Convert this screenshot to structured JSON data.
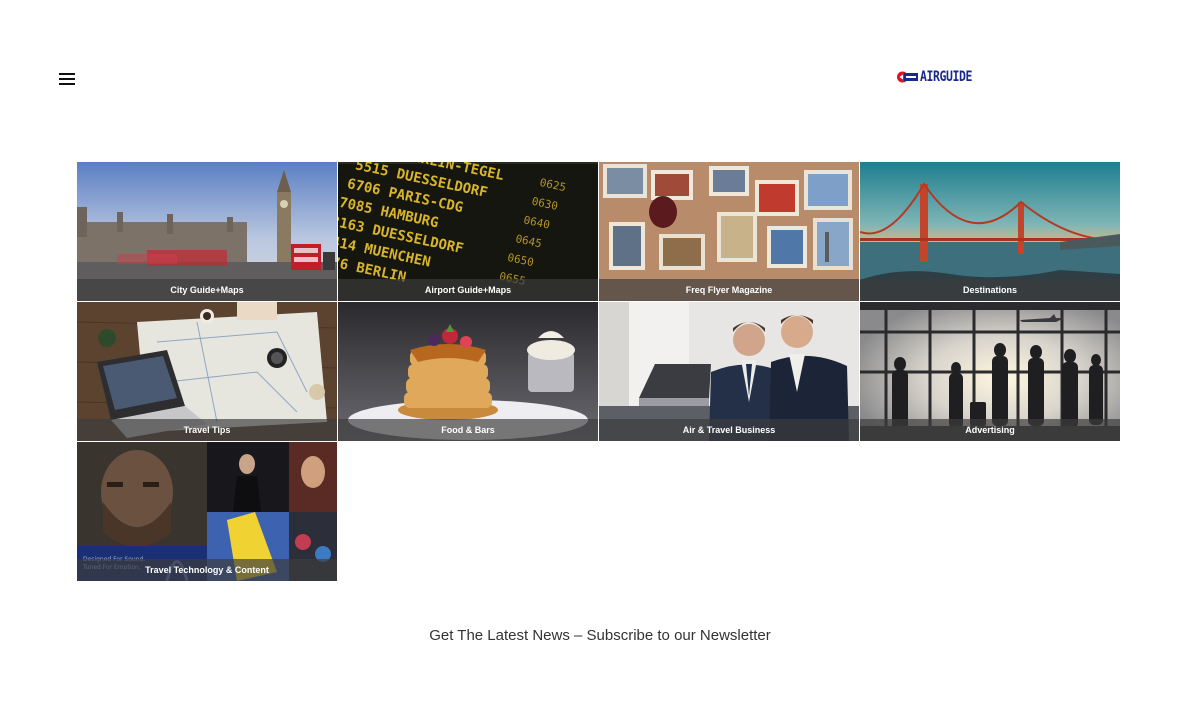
{
  "header": {
    "menu_icon": "hamburger-menu-icon",
    "logo_text": "AIRGUIDE",
    "logo_color": "#1a2a8c",
    "logo_accent": "#e3101e"
  },
  "tiles": [
    {
      "label": "City Guide+Maps",
      "image": "london-big-ben-red-bus-photo"
    },
    {
      "label": "Airport Guide+Maps",
      "image": "departure-board-photo"
    },
    {
      "label": "Freq Flyer Magazine",
      "image": "travel-postcards-photo"
    },
    {
      "label": "Destinations",
      "image": "golden-gate-bridge-photo"
    },
    {
      "label": "Travel Tips",
      "image": "map-laptop-desk-photo"
    },
    {
      "label": "Food & Bars",
      "image": "pancakes-photo"
    },
    {
      "label": "Air & Travel Business",
      "image": "businessmen-laptop-photo"
    },
    {
      "label": "Advertising",
      "image": "airport-silhouettes-photo"
    },
    {
      "label": "Travel Technology & Content",
      "image": "media-collage-photo"
    }
  ],
  "footer": {
    "newsletter_text": "Get The Latest News – Subscribe to our Newsletter"
  }
}
